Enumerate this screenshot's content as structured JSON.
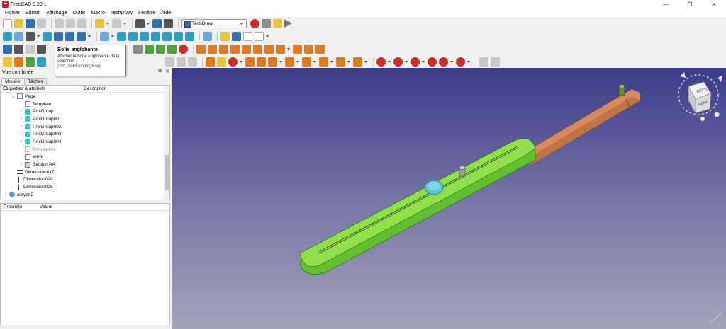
{
  "window": {
    "title": "FreeCAD 0.20.1",
    "controls": [
      "—",
      "❐",
      "✕"
    ]
  },
  "menu": [
    "Fichier",
    "Edition",
    "Affichage",
    "Outils",
    "Macro",
    "TechDraw",
    "Fenêtre",
    "Aide"
  ],
  "toolbar": {
    "workbench": "TechDraw"
  },
  "tooltip": {
    "title": "Boîte englobante",
    "text": "Afficher la boîte englobante de la sélection.",
    "command": "(Std_SelBoundingBox)"
  },
  "combo_view": {
    "title": "Vue combinée",
    "tabs": [
      "Modèle",
      "Tâches"
    ],
    "tree_headers": [
      "Étiquettes & attributs",
      "Description"
    ],
    "items": [
      {
        "label": "Page",
        "depth": 1,
        "icon": "page",
        "arrow": "v"
      },
      {
        "label": "Template",
        "depth": 2,
        "icon": "tmpl",
        "arrow": ""
      },
      {
        "label": "ProjGroup",
        "depth": 2,
        "icon": "proj",
        "arrow": ">"
      },
      {
        "label": "ProjGroup001",
        "depth": 2,
        "icon": "proj",
        "arrow": ">"
      },
      {
        "label": "ProjGroup002",
        "depth": 2,
        "icon": "proj",
        "arrow": ">"
      },
      {
        "label": "ProjGroup003",
        "depth": 2,
        "icon": "proj",
        "arrow": ">"
      },
      {
        "label": "ProjGroup004",
        "depth": 2,
        "icon": "proj",
        "arrow": ">"
      },
      {
        "label": "Annotation",
        "depth": 2,
        "icon": "ann",
        "arrow": "",
        "muted": true
      },
      {
        "label": "View",
        "depth": 2,
        "icon": "view",
        "arrow": ""
      },
      {
        "label": "Section  AA",
        "depth": 2,
        "icon": "sect",
        "arrow": ">"
      },
      {
        "label": "Dimension017",
        "depth": 1,
        "icon": "dimh",
        "arrow": ""
      },
      {
        "label": "Dimension020",
        "depth": 1,
        "icon": "dimv",
        "arrow": ""
      },
      {
        "label": "Dimension025",
        "depth": 1,
        "icon": "dimv",
        "arrow": ""
      },
      {
        "label": "crayon2",
        "depth": 0,
        "icon": "part",
        "arrow": ">"
      }
    ],
    "prop_headers": [
      "Propriété",
      "Valeur"
    ]
  },
  "navcube": {
    "face_top": "BOTTOM",
    "face_side": "REAR"
  },
  "colors": {
    "viewport_top": "#3b3b8a",
    "viewport_bottom": "#a3a3ba",
    "part_green": "#8fe04a",
    "part_orange": "#d88a5a",
    "knob_cyan": "#5cc4d6"
  }
}
